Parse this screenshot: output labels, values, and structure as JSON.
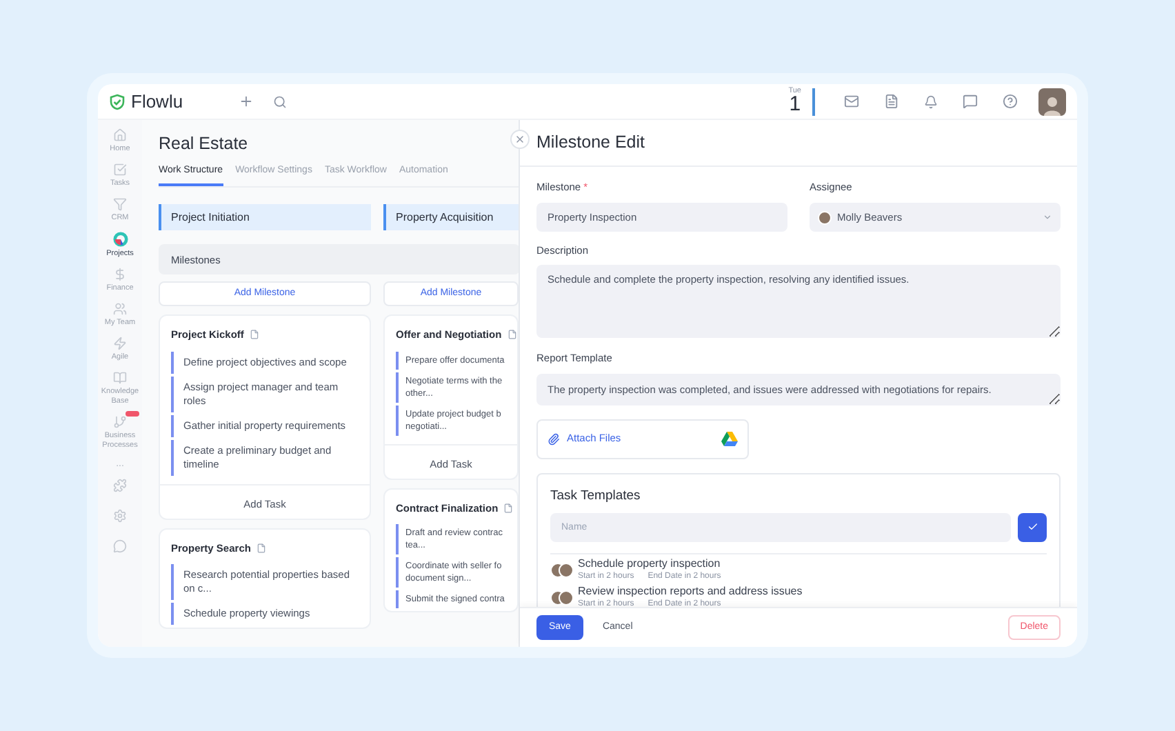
{
  "header": {
    "logo": "Flowlu",
    "date": {
      "weekday": "Tue",
      "day": "1"
    }
  },
  "sidebar": {
    "items": [
      {
        "label": "Home",
        "selected": false
      },
      {
        "label": "Tasks",
        "selected": false
      },
      {
        "label": "CRM",
        "selected": false
      },
      {
        "label": "Projects",
        "selected": true
      },
      {
        "label": "Finance",
        "selected": false
      },
      {
        "label": "My Team",
        "selected": false
      },
      {
        "label": "Agile",
        "selected": false
      },
      {
        "label": "Knowledge Base",
        "selected": false
      },
      {
        "label": "Business Processes",
        "selected": false,
        "badge": true
      }
    ],
    "more": "..."
  },
  "project": {
    "title": "Real Estate",
    "tabs": [
      {
        "label": "Work Structure",
        "selected": true
      },
      {
        "label": "Workflow Settings",
        "selected": false
      },
      {
        "label": "Task Workflow",
        "selected": false
      },
      {
        "label": "Automation",
        "selected": false
      }
    ]
  },
  "milestones_label": "Milestones",
  "stages": [
    {
      "name": "Project Initiation",
      "add_milestone": "Add Milestone",
      "milestones": [
        {
          "title": "Project Kickoff",
          "tasks": [
            "Define project objectives and scope",
            "Assign project manager and team roles",
            "Gather initial property requirements",
            "Create a preliminary budget and timeline"
          ],
          "add_task": "Add Task"
        },
        {
          "title": "Property Search",
          "tasks": [
            "Research potential properties based on c...",
            "Schedule property viewings"
          ]
        }
      ]
    },
    {
      "name": "Property Acquisition",
      "add_milestone": "Add Milestone",
      "milestones": [
        {
          "title": "Offer and Negotiation",
          "tasks": [
            "Prepare offer documenta",
            "Negotiate terms with the other...",
            "Update project budget b negotiati..."
          ],
          "add_task": "Add Task"
        },
        {
          "title": "Contract Finalization",
          "tasks": [
            "Draft and review contrac tea...",
            "Coordinate with seller fo document sign...",
            "Submit the signed contra"
          ]
        }
      ]
    }
  ],
  "panel": {
    "title": "Milestone Edit",
    "milestone": {
      "label": "Milestone",
      "required": "*",
      "value": "Property Inspection"
    },
    "assignee": {
      "label": "Assignee",
      "value": "Molly Beavers"
    },
    "description": {
      "label": "Description",
      "value": "Schedule and complete the property inspection, resolving any identified issues."
    },
    "report_template": {
      "label": "Report Template",
      "value": "The property inspection was completed, and issues were addressed with negotiations for repairs."
    },
    "attach": "Attach Files",
    "task_templates": {
      "title": "Task Templates",
      "placeholder": "Name",
      "items": [
        {
          "title": "Schedule property inspection",
          "start": "Start in 2 hours",
          "end": "End Date in 2 hours"
        },
        {
          "title": "Review inspection reports and address issues",
          "start": "Start in 2 hours",
          "end": "End Date in 2 hours"
        }
      ]
    },
    "buttons": {
      "save": "Save",
      "cancel": "Cancel",
      "delete": "Delete"
    }
  }
}
